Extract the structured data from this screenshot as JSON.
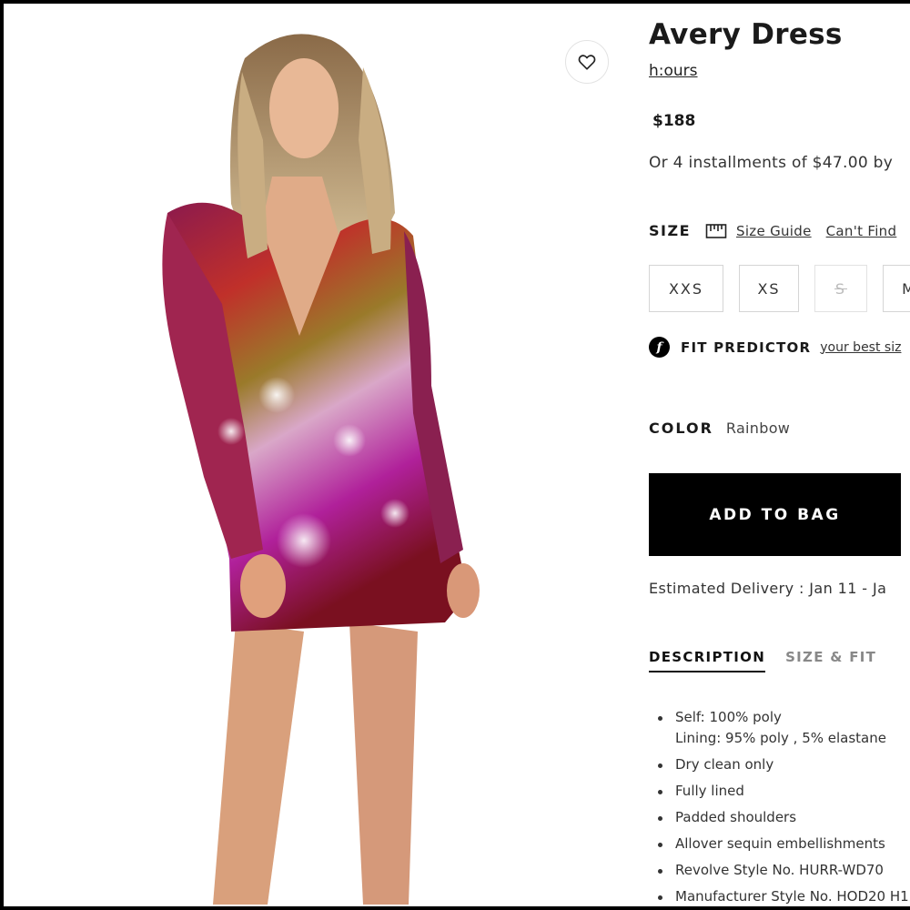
{
  "product": {
    "title": "Avery Dress",
    "brand": "h:ours",
    "price": "$188",
    "installments": "Or 4 installments of $47.00 by"
  },
  "wishlist": {
    "icon": "heart-icon"
  },
  "size": {
    "label": "SIZE",
    "guide_label": "Size Guide",
    "cant_find_label": "Can't Find",
    "options": [
      {
        "label": "XXS",
        "available": true
      },
      {
        "label": "XS",
        "available": true
      },
      {
        "label": "S",
        "available": false
      },
      {
        "label": "M",
        "available": true
      }
    ]
  },
  "fit_predictor": {
    "icon_glyph": "f",
    "label": "FIT PREDICTOR",
    "link": "your best siz"
  },
  "color": {
    "label": "COLOR",
    "value": "Rainbow"
  },
  "cta": {
    "add_to_bag": "ADD TO BAG"
  },
  "delivery": "Estimated Delivery :  Jan 11 - Ja",
  "tabs": [
    {
      "label": "DESCRIPTION",
      "active": true
    },
    {
      "label": "SIZE & FIT",
      "active": false
    }
  ],
  "description": [
    {
      "line1": "Self: 100% poly",
      "line2": "Lining: 95% poly , 5% elastane"
    },
    {
      "line1": "Dry clean only"
    },
    {
      "line1": "Fully lined"
    },
    {
      "line1": "Padded shoulders"
    },
    {
      "line1": "Allover sequin embellishments"
    },
    {
      "line1": "Revolve Style No. HURR-WD70"
    },
    {
      "line1": "Manufacturer Style No. HOD20 H1"
    }
  ]
}
